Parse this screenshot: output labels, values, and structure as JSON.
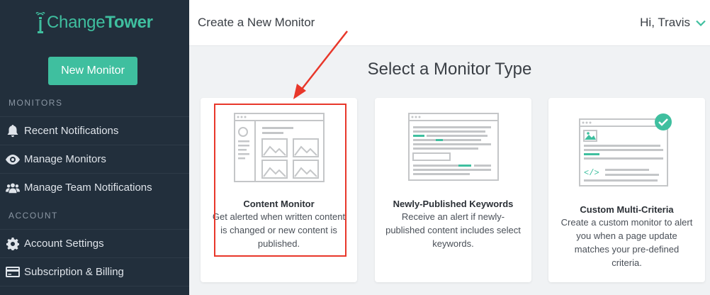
{
  "app": {
    "logo_part1": "Change",
    "logo_part2": "Tower"
  },
  "sidebar": {
    "new_button": "New Monitor",
    "monitors_heading": "MONITORS",
    "monitors_items": [
      {
        "label": "Recent Notifications",
        "icon": "bell-icon"
      },
      {
        "label": "Manage Monitors",
        "icon": "eye-icon"
      },
      {
        "label": "Manage Team Notifications",
        "icon": "users-icon"
      }
    ],
    "account_heading": "ACCOUNT",
    "account_items": [
      {
        "label": "Account Settings",
        "icon": "gear-icon"
      },
      {
        "label": "Subscription & Billing",
        "icon": "credit-card-icon"
      }
    ]
  },
  "header": {
    "title": "Create a New Monitor",
    "greeting": "Hi, Travis"
  },
  "main": {
    "title": "Select a Monitor Type",
    "cards": [
      {
        "title": "Content Monitor",
        "description": "Get alerted when written content is changed or new content is published.",
        "selected": true
      },
      {
        "title": "Newly-Published Keywords",
        "description": "Receive an alert if newly-published content includes select keywords.",
        "selected": false
      },
      {
        "title": "Custom Multi-Criteria",
        "description": "Create a custom monitor to alert you when a page update matches your pre-defined criteria.",
        "selected": false
      }
    ]
  },
  "colors": {
    "accent": "#3fbf9f",
    "sidebar": "#222f3c",
    "highlight": "#e8372a"
  }
}
